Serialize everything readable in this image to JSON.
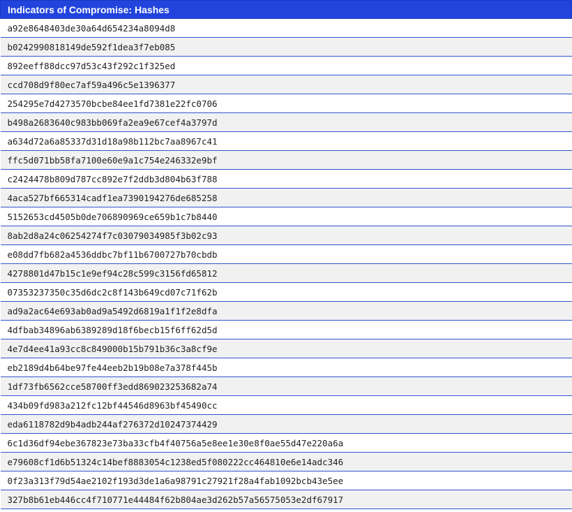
{
  "table": {
    "title": "Indicators of Compromise: Hashes",
    "header_color": "#2244dd",
    "rows": [
      "a92e8648403de30a64d654234a8094d8",
      "b0242990818149de592f1dea3f7eb085",
      "892eeff88dcc97d53c43f292c1f325ed",
      "ccd708d9f80ec7af59a496c5e1396377",
      "254295e7d4273570bcbe84ee1fd7381e22fc0706",
      "b498a2683640c983bb069fa2ea9e67cef4a3797d",
      "a634d72a6a85337d31d18a98b112bc7aa8967c41",
      "ffc5d071bb58fa7100e60e9a1c754e246332e9bf",
      "c2424478b809d787cc892e7f2ddb3d804b63f788",
      "4aca527bf665314cadf1ea7390194276de685258",
      "5152653cd4505b0de706890969ce659b1c7b8440",
      "8ab2d8a24c06254274f7c03079034985f3b02c93",
      "e08dd7fb682a4536ddbc7bf11b6700727b70cbdb",
      "4278801d47b15c1e9ef94c28c599c3156fd65812",
      "07353237350c35d6dc2c8f143b649cd07c71f62b",
      "ad9a2ac64e693ab0ad9a5492d6819a1f1f2e8dfa",
      "4dfbab34896ab6389289d18f6becb15f6ff62d5d",
      "4e7d4ee41a93cc8c849000b15b791b36c3a8cf9e",
      "eb2189d4b64be97fe44eeb2b19b08e7a378f445b",
      "1df73fb6562cce58700ff3edd869023253682a74",
      "434b09fd983a212fc12bf44546d8963bf45490cc",
      "eda6118782d9b4adb244af276372d10247374429",
      "6c1d36df94ebe367823e73ba33cfb4f40756a5e8ee1e30e8f0ae55d47e220a6a",
      "e79608cf1d6b51324c14bef8883054c1238ed5f080222cc464810e6e14adc346",
      "0f23a313f79d54ae2102f193d3de1a6a98791c27921f28a4fab1092bcb43e5ee",
      "327b8b61eb446cc4f710771e44484f62b804ae3d262b57a56575053e2df67917"
    ]
  }
}
